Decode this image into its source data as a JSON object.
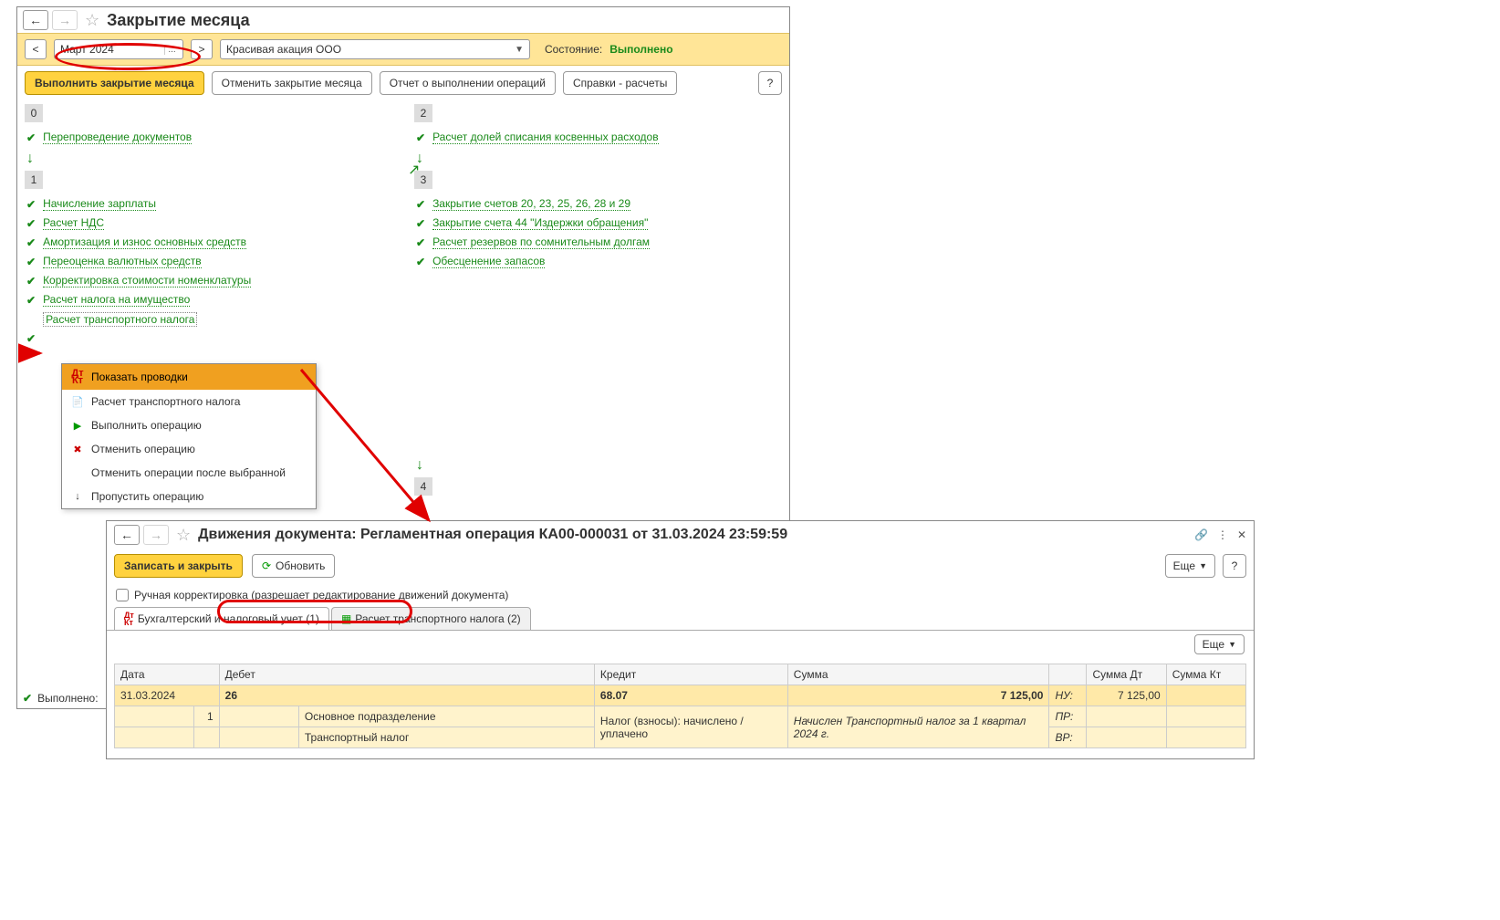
{
  "win1": {
    "title": "Закрытие месяца",
    "period": "Март 2024",
    "organization": "Красивая акация ООО",
    "state_label": "Состояние:",
    "state_value": "Выполнено",
    "buttons": {
      "run": "Выполнить закрытие месяца",
      "cancel": "Отменить закрытие месяца",
      "report": "Отчет о выполнении операций",
      "refs": "Справки - расчеты"
    },
    "sections": {
      "s0": "0",
      "s1": "1",
      "s2": "2",
      "s3": "3",
      "s4": "4"
    },
    "ops": {
      "op0_1": "Перепроведение документов",
      "op1_1": "Начисление зарплаты",
      "op1_2": "Расчет НДС",
      "op1_3": "Амортизация и износ основных средств",
      "op1_4": "Переоценка валютных средств",
      "op1_5": "Корректировка стоимости номенклатуры",
      "op1_6": "Расчет налога на имущество",
      "op1_7": "Расчет транспортного налога",
      "op2_1": "Расчет долей списания косвенных расходов",
      "op3_1": "Закрытие счетов 20, 23, 25, 26, 28 и 29",
      "op3_2": "Закрытие счета 44 \"Издержки обращения\"",
      "op3_3": "Расчет резервов по сомнительным долгам",
      "op3_4": "Обесценение запасов"
    },
    "context_menu": {
      "show_entries": "Показать проводки",
      "calc_tax": "Расчет транспортного налога",
      "run_op": "Выполнить операцию",
      "cancel_op": "Отменить операцию",
      "cancel_after": "Отменить операции после выбранной",
      "skip_op": "Пропустить операцию"
    },
    "footer_status": "Выполнено:"
  },
  "win2": {
    "title": "Движения документа: Регламентная операция КА00-000031 от 31.03.2024 23:59:59",
    "save_close": "Записать и закрыть",
    "refresh": "Обновить",
    "more": "Еще",
    "manual_edit": "Ручная корректировка (разрешает редактирование движений документа)",
    "tabs": {
      "tab1": "Бухгалтерский и налоговый учет (1)",
      "tab2": "Расчет транспортного налога (2)"
    },
    "headers": {
      "date": "Дата",
      "debit": "Дебет",
      "credit": "Кредит",
      "sum": "Сумма",
      "sum_dt": "Сумма Дт",
      "sum_kt": "Сумма Кт"
    },
    "indicators": {
      "nu": "НУ:",
      "pr": "ПР:",
      "vr": "ВР:"
    },
    "row1": {
      "date": "31.03.2024",
      "row_num": "1",
      "debit_acc": "26",
      "credit_acc": "68.07",
      "sum": "7 125,00",
      "sum_dt_nu": "7 125,00",
      "sub_debit": "Основное подразделение",
      "sub_credit": "Налог (взносы): начислено / уплачено",
      "comment": "Начислен Транспортный налог за 1 квартал 2024 г.",
      "sub_debit2": "Транспортный налог"
    }
  }
}
